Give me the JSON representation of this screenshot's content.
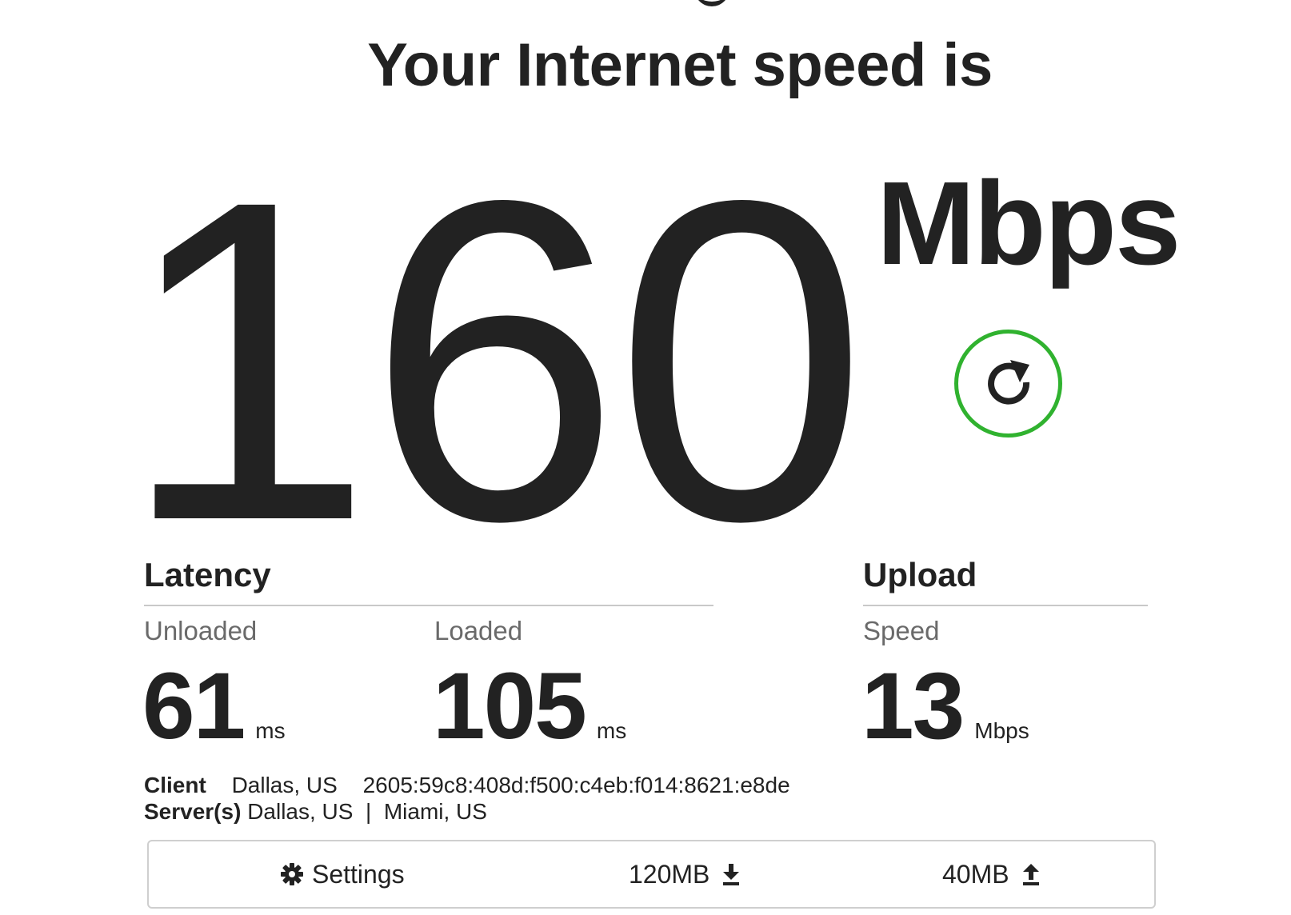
{
  "header": {
    "title": "Your Internet speed is"
  },
  "speed": {
    "value": "160",
    "units": "Mbps"
  },
  "refresh": {
    "icon": "refresh-icon",
    "accent_color": "#30b22f"
  },
  "latency": {
    "title": "Latency",
    "unloaded": {
      "label": "Unloaded",
      "value": "61",
      "unit": "ms"
    },
    "loaded": {
      "label": "Loaded",
      "value": "105",
      "unit": "ms"
    }
  },
  "upload": {
    "title": "Upload",
    "speed": {
      "label": "Speed",
      "value": "13",
      "unit": "Mbps"
    }
  },
  "client": {
    "label": "Client",
    "location": "Dallas, US",
    "ip": "2605:59c8:408d:f500:c4eb:f014:8621:e8de"
  },
  "servers": {
    "label": "Server(s)",
    "list": "Dallas, US  |  Miami, US"
  },
  "footer": {
    "settings_label": "Settings",
    "settings_icon": "gear-icon",
    "download_size": "120MB",
    "download_icon": "download-icon",
    "upload_size": "40MB",
    "upload_icon": "upload-icon"
  }
}
